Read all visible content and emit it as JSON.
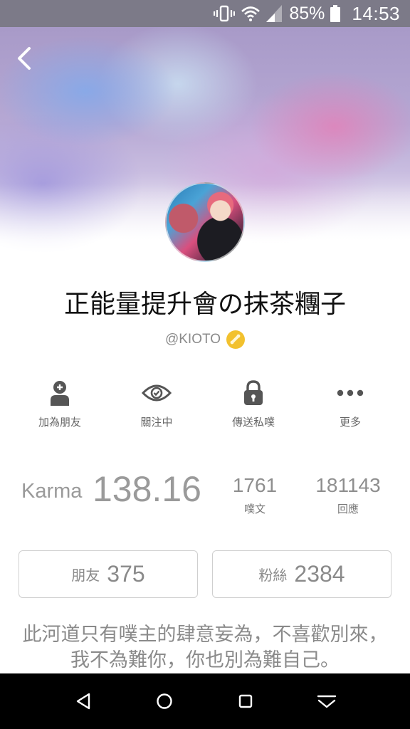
{
  "status_bar": {
    "battery": "85%",
    "time": "14:53",
    "icons": [
      "vibrate-icon",
      "wifi-icon",
      "cell-signal-icon",
      "battery-icon"
    ]
  },
  "header": {
    "back_icon": "chevron-left-icon"
  },
  "profile": {
    "display_name": "正能量提升會の抹茶糰子",
    "handle": "@KIOTO",
    "badge_icon": "gold-badge-icon",
    "badge_color": "#f2c12e"
  },
  "actions": [
    {
      "label": "加為朋友",
      "icon": "add-friend-icon"
    },
    {
      "label": "關注中",
      "icon": "eye-check-icon"
    },
    {
      "label": "傳送私噗",
      "icon": "lock-icon"
    },
    {
      "label": "更多",
      "icon": "more-dots-icon"
    }
  ],
  "stats": {
    "karma_label": "Karma",
    "karma_value": "138.16",
    "posts_count": "1761",
    "posts_label": "噗文",
    "replies_count": "181143",
    "replies_label": "回應"
  },
  "friends": {
    "label": "朋友",
    "count": "375"
  },
  "fans": {
    "label": "粉絲",
    "count": "2384"
  },
  "bio": "此河道只有噗主的肆意妄為，不喜歡別來，我不為難你，你也別為難自己。",
  "nav_bar": {
    "icons": [
      "nav-back-icon",
      "nav-home-icon",
      "nav-recents-icon",
      "nav-collapse-icon"
    ]
  }
}
